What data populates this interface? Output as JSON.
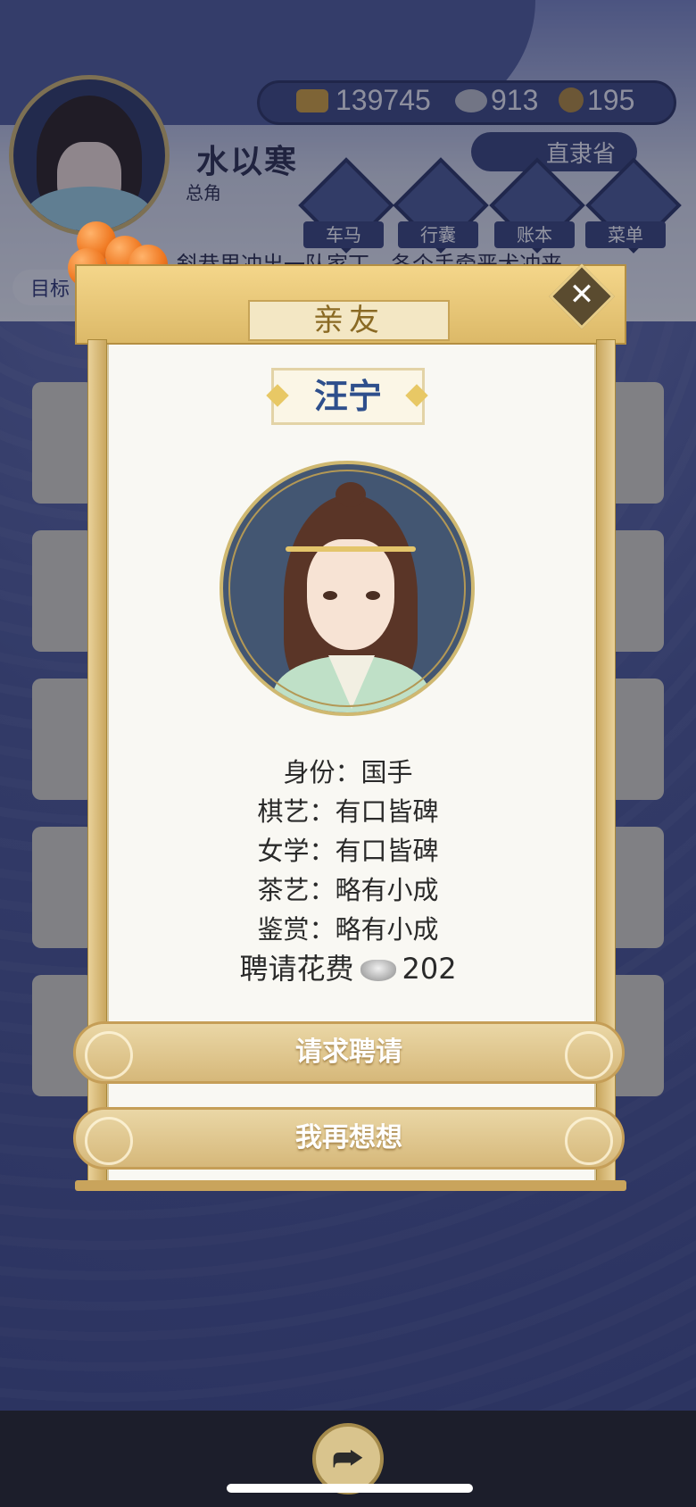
{
  "player": {
    "name": "水以寒",
    "role": "总角"
  },
  "currency": {
    "gold": "139745",
    "silver": "913",
    "coin": "195"
  },
  "location": "直隶省",
  "menu": [
    {
      "label": "车马",
      "icon": "carriage-icon"
    },
    {
      "label": "行囊",
      "icon": "bag-icon"
    },
    {
      "label": "账本",
      "icon": "ledger-icon"
    },
    {
      "label": "菜单",
      "icon": "more-icon"
    }
  ],
  "story_text": "村，斜巷里冲出一队家丁，各个手牵恶犬冲来",
  "goal_label": "目标",
  "modal": {
    "title": "亲友",
    "person_name": "汪宁",
    "info": [
      "身份：国手",
      "棋艺：有口皆碑",
      "女学：有口皆碑",
      "茶艺：略有小成",
      "鉴赏：略有小成"
    ],
    "fee_label": "聘请花费",
    "fee_value": "202",
    "primary_button": "请求聘请",
    "secondary_button": "我再想想"
  },
  "colors": {
    "accent_gold": "#d6b87a",
    "name_blue": "#2e4f8c",
    "bg_blue": "#4c5793"
  }
}
